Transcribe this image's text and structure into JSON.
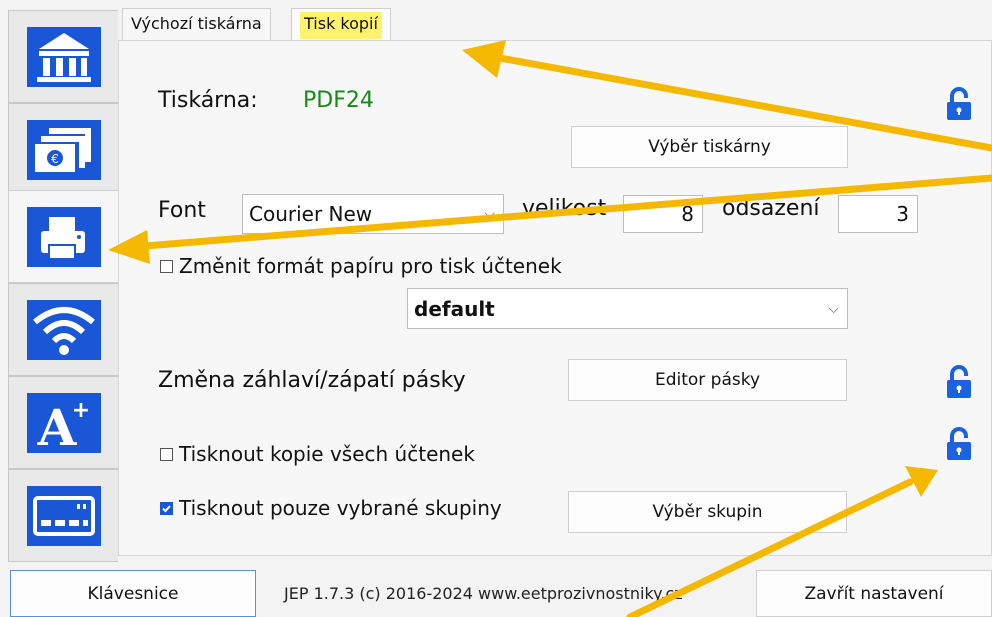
{
  "sidebar": {
    "items": [
      {
        "name": "bank",
        "icon": "bank-icon"
      },
      {
        "name": "cash",
        "icon": "cash-icon"
      },
      {
        "name": "printer",
        "icon": "printer-icon",
        "active": true
      },
      {
        "name": "wifi",
        "icon": "wifi-icon"
      },
      {
        "name": "font",
        "icon": "font-plus-icon"
      },
      {
        "name": "keyboard",
        "icon": "keyboard-icon"
      }
    ]
  },
  "tabs": [
    {
      "label": "Výchozí tiskárna"
    },
    {
      "label": "Tisk kopií",
      "active": true,
      "highlight": "#fff36b"
    }
  ],
  "printer": {
    "label": "Tiskárna:",
    "value": "PDF24",
    "value_color": "#168a16",
    "select_button": "Výběr tiskárny"
  },
  "font": {
    "label": "Font",
    "family": "Courier New",
    "size_label": "velikost",
    "size_value": "8",
    "offset_label": "odsazení",
    "offset_value": "3"
  },
  "paper": {
    "checkbox_label": "Změnit formát papíru pro tisk účtenek",
    "checked": false,
    "format": "default"
  },
  "header_footer": {
    "label": "Změna záhlaví/zápatí pásky",
    "button": "Editor pásky"
  },
  "copies": {
    "checkbox_label": "Tisknout kopie všech účtenek",
    "checked": false
  },
  "groups": {
    "checkbox_label": "Tisknout pouze vybrané skupiny",
    "checked": true,
    "button": "Výběr skupin"
  },
  "footer": {
    "keyboard_button": "Klávesnice",
    "info": "JEP 1.7.3 (c) 2016-2024 www.eetprozivnostniky.cz",
    "close_button": "Zavřít nastavení"
  },
  "colors": {
    "accent": "#1a57d6",
    "arrow": "#f5b800",
    "lock": "#1a62e0"
  }
}
